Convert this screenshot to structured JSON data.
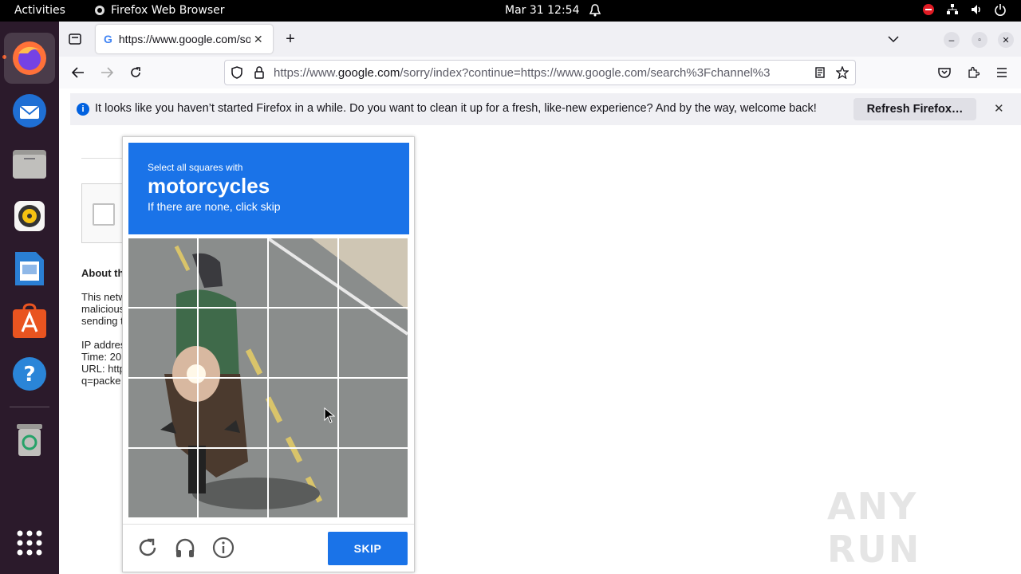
{
  "topbar": {
    "activities": "Activities",
    "app_name": "Firefox Web Browser",
    "clock": "Mar 31  12:54"
  },
  "dock": {
    "items": [
      "firefox",
      "thunderbird",
      "files",
      "rhythmbox",
      "libreoffice-writer",
      "software-center",
      "help",
      "trash",
      "show-apps"
    ]
  },
  "browser": {
    "tab_title": "https://www.google.com/sorry/index?continue",
    "url_domain": "google.com",
    "url_prefix": "https://www.",
    "url_rest": "/sorry/index?continue=https://www.google.com/search%3Fchannel%3",
    "notification": {
      "message": "It looks like you haven’t started Firefox in a while. Do you want to clean it up for a fresh, like-new experience? And by the way, welcome back!",
      "button": "Refresh Firefox…"
    }
  },
  "page": {
    "about": "About th",
    "line1": "This netw",
    "line2": "malicious",
    "line3": "sending t",
    "ip": "IP addres",
    "time": "Time: 20",
    "url": "URL: http",
    "q": "q=packe"
  },
  "captcha": {
    "instruction": "Select all squares with",
    "target": "motorcycles",
    "hint": "If there are none, click skip",
    "skip_label": "SKIP"
  },
  "watermark": "ANY RUN",
  "colors": {
    "captcha_blue": "#1a73e8",
    "dock_bg": "#2b1a2b",
    "topbar_bg": "#000000"
  }
}
